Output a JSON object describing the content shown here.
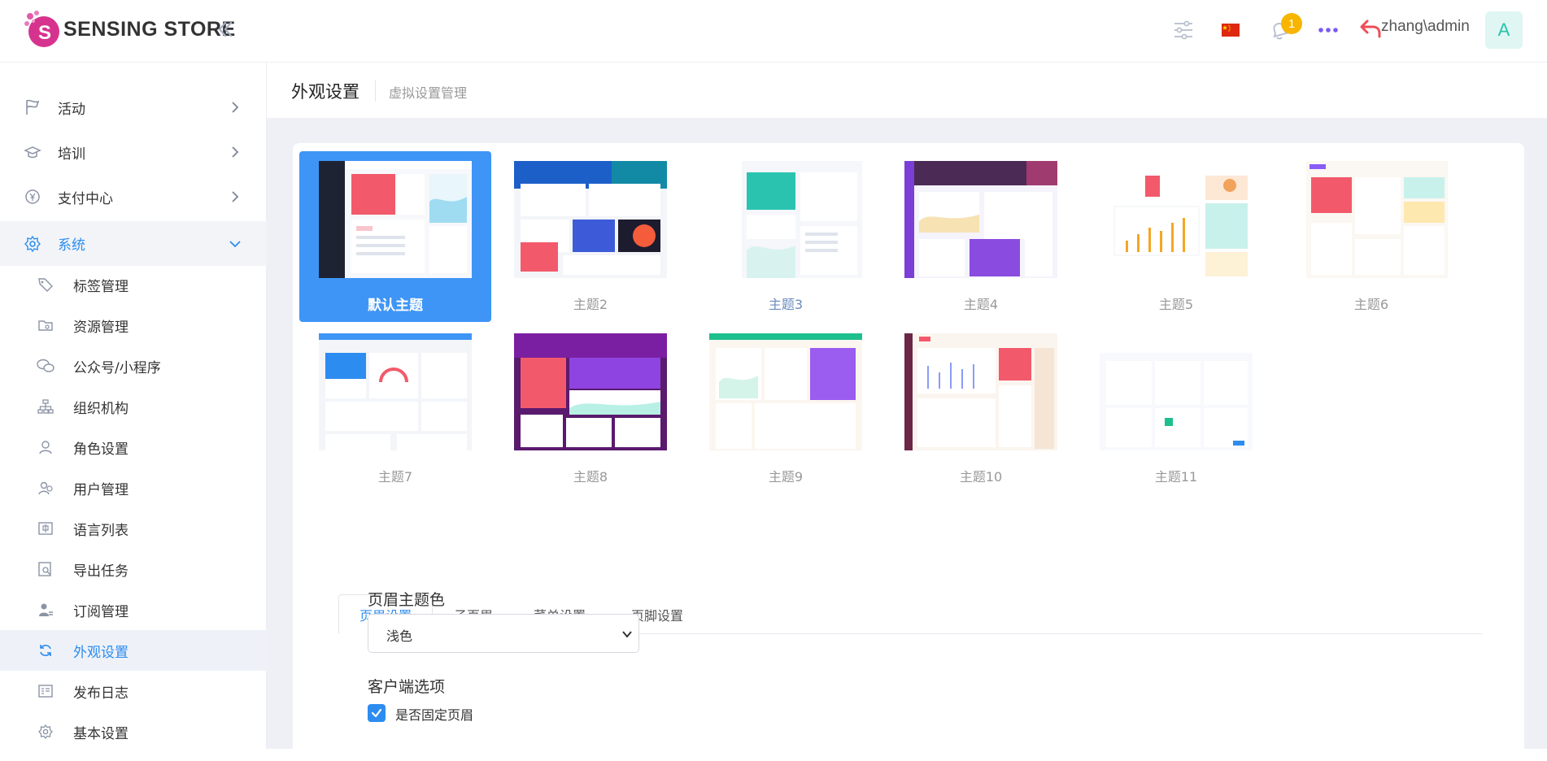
{
  "brand": {
    "name": "SENSING STORE",
    "logo_letter": "S"
  },
  "header": {
    "notification_count": "1",
    "user": "zhang\\admin",
    "avatar_letter": "A"
  },
  "sidebar": {
    "menus": [
      {
        "label": "活动",
        "icon": "flag-icon"
      },
      {
        "label": "培训",
        "icon": "graduation-cap-icon"
      },
      {
        "label": "支付中心",
        "icon": "yuan-coin-icon"
      },
      {
        "label": "系统",
        "icon": "gear-icon"
      }
    ],
    "submenu": [
      {
        "label": "标签管理",
        "icon": "tag-icon"
      },
      {
        "label": "资源管理",
        "icon": "folder-icon"
      },
      {
        "label": "公众号/小程序",
        "icon": "wechat-icon"
      },
      {
        "label": "组织机构",
        "icon": "org-chart-icon"
      },
      {
        "label": "角色设置",
        "icon": "user-icon"
      },
      {
        "label": "用户管理",
        "icon": "users-icon"
      },
      {
        "label": "语言列表",
        "icon": "language-icon"
      },
      {
        "label": "导出任务",
        "icon": "export-icon"
      },
      {
        "label": "订阅管理",
        "icon": "subscription-icon"
      },
      {
        "label": "外观设置",
        "icon": "refresh-icon"
      },
      {
        "label": "发布日志",
        "icon": "log-icon"
      },
      {
        "label": "基本设置",
        "icon": "settings-icon"
      }
    ]
  },
  "page": {
    "title": "外观设置",
    "crumb": "虚拟设置管理"
  },
  "themes": [
    {
      "label": "默认主题",
      "selected": true
    },
    {
      "label": "主题2"
    },
    {
      "label": "主题3"
    },
    {
      "label": "主题4"
    },
    {
      "label": "主题5"
    },
    {
      "label": "主题6"
    },
    {
      "label": "主题7"
    },
    {
      "label": "主题8"
    },
    {
      "label": "主题9"
    },
    {
      "label": "主题10"
    },
    {
      "label": "主题11"
    }
  ],
  "tabs": [
    "页眉设置",
    "子页眉",
    "菜单设置",
    "页脚设置"
  ],
  "form": {
    "header_color_label": "页眉主题色",
    "header_color_value": "浅色",
    "client_options_label": "客户端选项",
    "fixed_header_label": "是否固定页眉",
    "fixed_header_checked": true
  },
  "colors": {
    "accent": "#2d8cf0",
    "selected_theme": "#3e95f6",
    "badge": "#f7b500"
  }
}
